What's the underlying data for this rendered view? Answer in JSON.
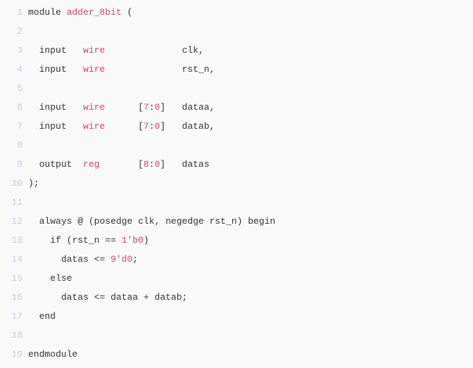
{
  "lines": [
    {
      "n": "1",
      "html": "<span class='kw'>module</span> <span class='ident'>adder_8bit</span> <span class='punct'>(</span>"
    },
    {
      "n": "2",
      "html": ""
    },
    {
      "n": "3",
      "html": "  <span class='kw'>input</span>   <span class='type'>wire</span>              <span class='plain'>clk</span><span class='punct'>,</span>"
    },
    {
      "n": "4",
      "html": "  <span class='kw'>input</span>   <span class='type'>wire</span>              <span class='plain'>rst_n</span><span class='punct'>,</span>"
    },
    {
      "n": "5",
      "html": ""
    },
    {
      "n": "6",
      "html": "  <span class='kw'>input</span>   <span class='type'>wire</span>      <span class='punct'>[</span><span class='num'>7</span><span class='punct'>:</span><span class='num'>0</span><span class='punct'>]</span>   <span class='plain'>dataa</span><span class='punct'>,</span>"
    },
    {
      "n": "7",
      "html": "  <span class='kw'>input</span>   <span class='type'>wire</span>      <span class='punct'>[</span><span class='num'>7</span><span class='punct'>:</span><span class='num'>0</span><span class='punct'>]</span>   <span class='plain'>datab</span><span class='punct'>,</span>"
    },
    {
      "n": "8",
      "html": ""
    },
    {
      "n": "9",
      "html": "  <span class='kw'>output</span>  <span class='type'>reg</span>       <span class='punct'>[</span><span class='num'>8</span><span class='punct'>:</span><span class='num'>0</span><span class='punct'>]</span>   <span class='plain'>datas</span>"
    },
    {
      "n": "10",
      "html": "<span class='punct'>);</span>"
    },
    {
      "n": "11",
      "html": ""
    },
    {
      "n": "12",
      "html": "  <span class='kw'>always</span> <span class='op'>@</span> <span class='punct'>(</span><span class='kw'>posedge</span> <span class='plain'>clk</span><span class='punct'>,</span> <span class='kw'>negedge</span> <span class='plain'>rst_n</span><span class='punct'>)</span> <span class='kw'>begin</span>"
    },
    {
      "n": "13",
      "html": "    <span class='kw'>if</span> <span class='punct'>(</span><span class='plain'>rst_n</span> <span class='op'>==</span> <span class='num'>1'b0</span><span class='punct'>)</span>"
    },
    {
      "n": "14",
      "html": "      <span class='plain'>datas</span> <span class='op'>&lt;=</span> <span class='num'>9'd0</span><span class='punct'>;</span>"
    },
    {
      "n": "15",
      "html": "    <span class='kw'>else</span>"
    },
    {
      "n": "16",
      "html": "      <span class='plain'>datas</span> <span class='op'>&lt;=</span> <span class='plain'>dataa</span> <span class='op'>+</span> <span class='plain'>datab</span><span class='punct'>;</span>"
    },
    {
      "n": "17",
      "html": "  <span class='kw'>end</span>"
    },
    {
      "n": "18",
      "html": ""
    },
    {
      "n": "19",
      "html": "<span class='kw'>endmodule</span>"
    }
  ]
}
